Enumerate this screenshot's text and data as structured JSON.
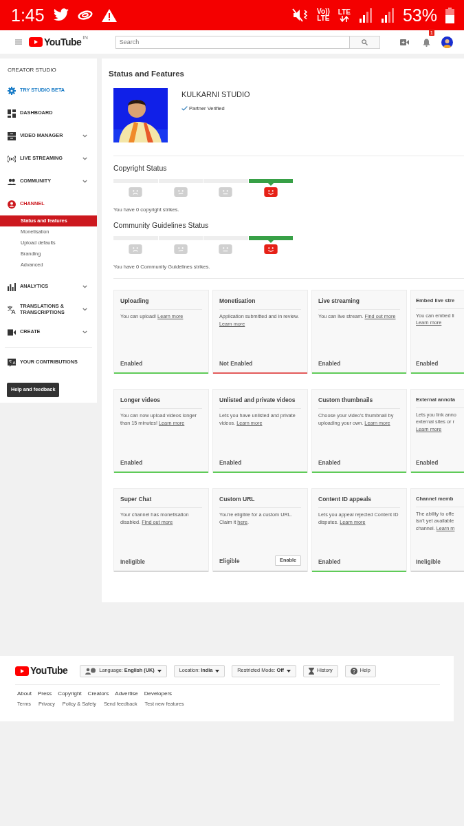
{
  "status_bar": {
    "time": "1:45",
    "volte": [
      "Vo))",
      "LTE"
    ],
    "network": "LTE",
    "battery": "53%"
  },
  "header": {
    "logo": "YouTube",
    "region": "IN",
    "search": {
      "placeholder": "Search"
    },
    "notifications": "1"
  },
  "sidebar": {
    "title": "CREATOR STUDIO",
    "items": [
      {
        "label": "TRY STUDIO BETA",
        "kind": "promo",
        "expandable": false,
        "selected": false
      },
      {
        "label": "DASHBOARD",
        "kind": "nav",
        "expandable": false,
        "selected": false
      },
      {
        "label": "VIDEO MANAGER",
        "kind": "nav",
        "expandable": true,
        "selected": false
      },
      {
        "label": "LIVE STREAMING",
        "kind": "nav",
        "expandable": true,
        "selected": false
      },
      {
        "label": "COMMUNITY",
        "kind": "nav",
        "expandable": true,
        "selected": false
      },
      {
        "label": "CHANNEL",
        "kind": "nav",
        "expandable": false,
        "selected": true,
        "children": [
          {
            "label": "Status and features",
            "selected": true
          },
          {
            "label": "Monetisation",
            "selected": false
          },
          {
            "label": "Upload defaults",
            "selected": false
          },
          {
            "label": "Branding",
            "selected": false
          },
          {
            "label": "Advanced",
            "selected": false
          }
        ]
      },
      {
        "label": "ANALYTICS",
        "kind": "nav",
        "expandable": true,
        "selected": false
      },
      {
        "label": "TRANSLATIONS & TRANSCRIPTIONS",
        "kind": "nav",
        "expandable": true,
        "selected": false
      },
      {
        "label": "CREATE",
        "kind": "nav",
        "expandable": true,
        "selected": false
      }
    ],
    "extra_item": "YOUR CONTRIBUTIONS",
    "help_button": "Help and feedback"
  },
  "main": {
    "title": "Status and Features",
    "channel": {
      "name": "KULKARNI STUDIO",
      "badge": "Partner Verified"
    },
    "strike_sections": [
      {
        "title": "Copyright Status",
        "segments": [
          {
            "selected": false
          },
          {
            "selected": false
          },
          {
            "selected": false
          },
          {
            "selected": true
          }
        ],
        "summary": "You have 0 copyright strikes."
      },
      {
        "title": "Community Guidelines Status",
        "segments": [
          {
            "selected": false
          },
          {
            "selected": false
          },
          {
            "selected": false
          },
          {
            "selected": true
          }
        ],
        "summary": "You have 0 Community Guidelines strikes."
      }
    ],
    "features": [
      {
        "title": "Uploading",
        "description": [
          {
            "text": "You can upload!",
            "link": "Learn more"
          }
        ],
        "status": "Enabled",
        "color": "#5fcb58",
        "clipped": false
      },
      {
        "title": "Monetisation",
        "description": [
          {
            "text": "Application submitted and in review.",
            "link": "Learn more"
          }
        ],
        "status": "Not Enabled",
        "color": "#e35a5a",
        "clipped": false
      },
      {
        "title": "Live streaming",
        "description": [
          {
            "text": "You can live stream.",
            "link": "Find out more"
          }
        ],
        "status": "Enabled",
        "color": "#5fcb58",
        "clipped": false
      },
      {
        "title": "Embed live stre",
        "description": [
          {
            "text": "You can embed li"
          },
          {
            "link": "Learn more"
          }
        ],
        "status": "Enabled",
        "color": "#5fcb58",
        "clipped": true
      },
      {
        "title": "Longer videos",
        "description": [
          {
            "text": "You can now upload videos longer than 15 minutes!",
            "link": "Learn more"
          }
        ],
        "status": "Enabled",
        "color": "#5fcb58",
        "clipped": false
      },
      {
        "title": "Unlisted and private videos",
        "description": [
          {
            "text": "Lets you have unlisted and private videos.",
            "link": "Learn more"
          }
        ],
        "status": "Enabled",
        "color": "#5fcb58",
        "clipped": false
      },
      {
        "title": "Custom thumbnails",
        "description": [
          {
            "text": "Choose your video's thumbnail by uploading your own.",
            "link": "Learn more"
          }
        ],
        "status": "Enabled",
        "color": "#5fcb58",
        "clipped": false
      },
      {
        "title": "External annota",
        "description": [
          {
            "text": "Lets you link anno"
          },
          {
            "text": "external sites or r"
          },
          {
            "link": "Learn more"
          }
        ],
        "status": "Enabled",
        "color": "#5fcb58",
        "clipped": true
      },
      {
        "title": "Super Chat",
        "description": [
          {
            "text": "Your channel has monetisation disabled.",
            "link": "Find out more"
          }
        ],
        "status": "Ineligible",
        "color": "#d6d6d6",
        "clipped": false
      },
      {
        "title": "Custom URL",
        "description": [
          {
            "text": "You're eligible for a custom URL. Claim it",
            "link": "here",
            "after": "."
          }
        ],
        "status": "Eligible",
        "color": "#d6d6d6",
        "action": "Enable",
        "clipped": false
      },
      {
        "title": "Content ID appeals",
        "description": [
          {
            "text": "Lets you appeal rejected Content ID disputes.",
            "link": "Learn more"
          }
        ],
        "status": "Enabled",
        "color": "#5fcb58",
        "clipped": false
      },
      {
        "title": "Channel memb",
        "description": [
          {
            "text": "The ability to offe"
          },
          {
            "text": "isn't yet available"
          },
          {
            "text": "channel.",
            "link": "Learn m"
          }
        ],
        "status": "Ineligible",
        "color": "#d6d6d6",
        "clipped": true
      }
    ]
  },
  "footer": {
    "logo": "YouTube",
    "controls": [
      {
        "kind": "language",
        "label": "Language: **English (UK)**"
      },
      {
        "kind": "menu",
        "label": "Location: **India**"
      },
      {
        "kind": "menu",
        "label": "Restricted Mode: **Off**"
      },
      {
        "kind": "history",
        "label": "History"
      },
      {
        "kind": "help",
        "label": "Help"
      }
    ],
    "links": [
      "About",
      "Press",
      "Copyright",
      "Creators",
      "Advertise",
      "Developers"
    ],
    "small_links": [
      "Terms",
      "Privacy",
      "Policy & Safety",
      "Send feedback",
      "Test new features"
    ]
  }
}
